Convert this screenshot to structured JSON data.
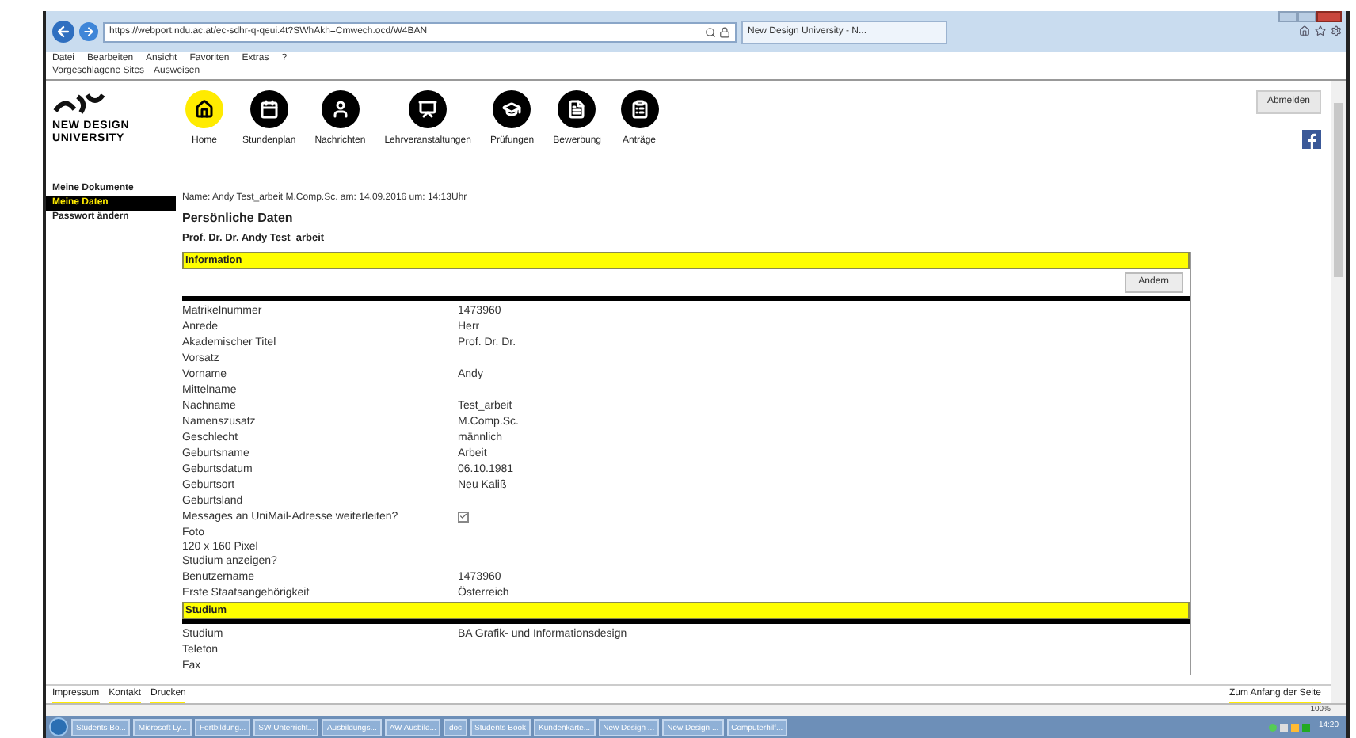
{
  "browser": {
    "url": "https://webport.ndu.ac.at/ec-sdhr-q-qeui.4t?SWhAkh=Cmwech.ocd/W4BAN",
    "tab": "New Design University - N...",
    "menu": [
      "Datei",
      "Bearbeiten",
      "Ansicht",
      "Favoriten",
      "Extras",
      "?"
    ],
    "favorites": [
      "Vorgeschlagene Sites",
      "Ausweisen"
    ],
    "zoom": "100%"
  },
  "header": {
    "logo": "NEW DESIGN",
    "logo_line2": "UNIVERSITY",
    "logout": "Abmelden",
    "nav": [
      {
        "label": "Home",
        "selected": true
      },
      {
        "label": "Stundenplan",
        "selected": false
      },
      {
        "label": "Nachrichten",
        "selected": false
      },
      {
        "label": "Lehrveranstaltungen",
        "selected": false
      },
      {
        "label": "Prüfungen",
        "selected": false
      },
      {
        "label": "Bewerbung",
        "selected": false
      },
      {
        "label": "Anträge",
        "selected": false
      }
    ]
  },
  "sidebar": {
    "items": [
      {
        "label": "Meine Dokumente",
        "selected": false
      },
      {
        "label": "Meine Daten",
        "selected": true
      },
      {
        "label": "Passwort ändern",
        "selected": false
      }
    ]
  },
  "content": {
    "meta": "Name: Andy Test_arbeit M.Comp.Sc. am: 14.09.2016 um: 14:13Uhr",
    "title": "Persönliche Daten",
    "person": "Prof. Dr. Dr. Andy Test_arbeit",
    "sections": [
      {
        "title": "Information",
        "button": "Ändern",
        "rows": [
          {
            "kind": "text",
            "label": "Matrikelnummer",
            "value": "1473960"
          },
          {
            "kind": "text",
            "label": "Anrede",
            "value": "Herr"
          },
          {
            "kind": "text",
            "label": "Akademischer Titel",
            "value": "Prof. Dr. Dr."
          },
          {
            "kind": "text",
            "label": "Vorsatz"
          },
          {
            "kind": "text",
            "label": "Vorname",
            "value": "Andy"
          },
          {
            "kind": "text",
            "label": "Mittelname"
          },
          {
            "kind": "text",
            "label": "Nachname",
            "value": "Test_arbeit"
          },
          {
            "kind": "text",
            "label": "Namenszusatz",
            "value": "M.Comp.Sc."
          },
          {
            "kind": "text",
            "label": "Geschlecht",
            "value": "männlich"
          },
          {
            "kind": "text",
            "label": "Geburtsname",
            "value": "Arbeit"
          },
          {
            "kind": "text",
            "label": "Geburtsdatum",
            "value": "06.10.1981"
          },
          {
            "kind": "text",
            "label": "Geburtsort",
            "value": "Neu Kaliß"
          },
          {
            "kind": "text",
            "label": "Geburtsland"
          },
          {
            "kind": "checkbox",
            "label": "Messages an UniMail-Adresse weiterleiten?",
            "checked": true
          },
          {
            "kind": "photo",
            "label": "Foto",
            "note": "120 x 160 Pixel"
          },
          {
            "kind": "text",
            "label": "Studium anzeigen?"
          },
          {
            "kind": "text",
            "label": "Benutzername",
            "value": "1473960"
          },
          {
            "kind": "text",
            "label": "Erste Staatsangehörigkeit",
            "value": "Österreich"
          }
        ]
      },
      {
        "title": "Studium",
        "rows": [
          {
            "kind": "text",
            "label": "Studium",
            "value": "BA Grafik- und Informationsdesign"
          },
          {
            "kind": "text",
            "label": "Telefon"
          },
          {
            "kind": "text",
            "label": "Fax"
          }
        ]
      }
    ]
  },
  "footer": {
    "links": [
      "Impressum",
      "Kontakt",
      "Drucken"
    ],
    "top_link": "Zum Anfang der Seite"
  },
  "taskbar": {
    "items": [
      "Students Bo...",
      "Microsoft Ly...",
      "Fortbildung...",
      "SW Unterricht...",
      "Ausbildungs...",
      "AW Ausbild...",
      "doc",
      "Students Book",
      "Kundenkarte...",
      "New Design ...",
      "New Design ...",
      "Computerhilf..."
    ],
    "clock": "14:20"
  }
}
